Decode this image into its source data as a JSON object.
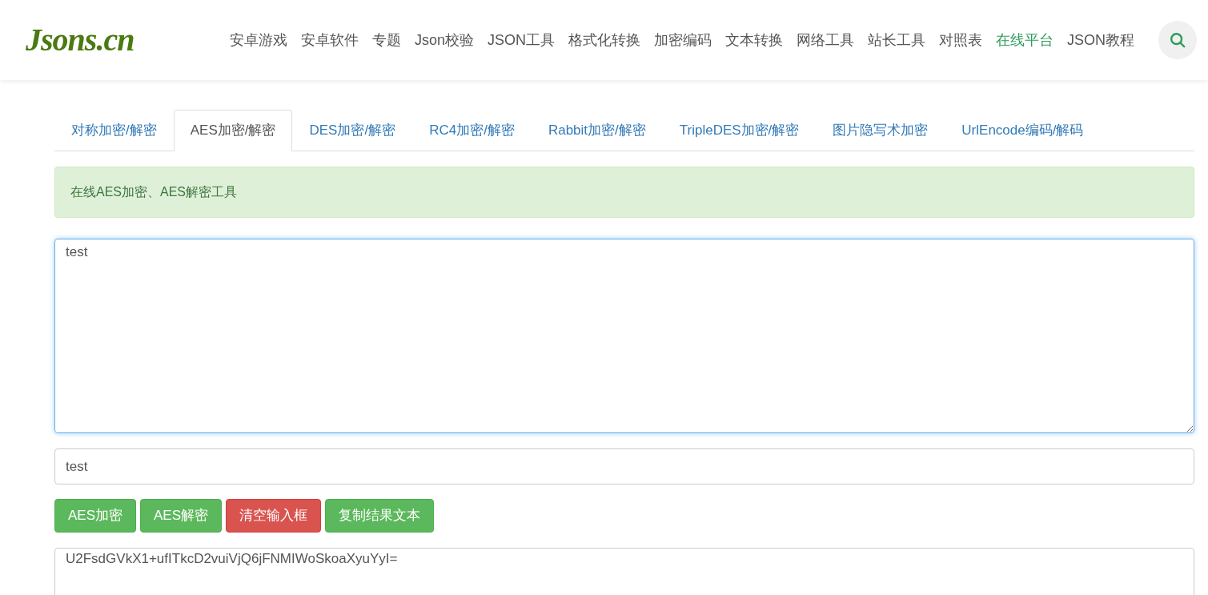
{
  "logo": "Jsons.cn",
  "nav": [
    {
      "label": "安卓游戏",
      "selected": false
    },
    {
      "label": "安卓软件",
      "selected": false
    },
    {
      "label": "专题",
      "selected": false
    },
    {
      "label": "Json校验",
      "selected": false
    },
    {
      "label": "JSON工具",
      "selected": false
    },
    {
      "label": "格式化转换",
      "selected": false
    },
    {
      "label": "加密编码",
      "selected": false
    },
    {
      "label": "文本转换",
      "selected": false
    },
    {
      "label": "网络工具",
      "selected": false
    },
    {
      "label": "站长工具",
      "selected": false
    },
    {
      "label": "对照表",
      "selected": false
    },
    {
      "label": "在线平台",
      "selected": true
    },
    {
      "label": "JSON教程",
      "selected": false
    }
  ],
  "tabs": [
    {
      "label": "对称加密/解密",
      "selected": false
    },
    {
      "label": "AES加密/解密",
      "selected": true
    },
    {
      "label": "DES加密/解密",
      "selected": false
    },
    {
      "label": "RC4加密/解密",
      "selected": false
    },
    {
      "label": "Rabbit加密/解密",
      "selected": false
    },
    {
      "label": "TripleDES加密/解密",
      "selected": false
    },
    {
      "label": "图片隐写术加密",
      "selected": false
    },
    {
      "label": "UrlEncode编码/解码",
      "selected": false
    }
  ],
  "notice": "在线AES加密、AES解密工具",
  "input_text": {
    "value": "test"
  },
  "key_field": {
    "value": "test"
  },
  "buttons": [
    {
      "label": "AES加密",
      "kind": "success"
    },
    {
      "label": "AES解密",
      "kind": "success"
    },
    {
      "label": "清空输入框",
      "kind": "danger"
    },
    {
      "label": "复制结果文本",
      "kind": "success"
    }
  ],
  "output_text": {
    "value": "U2FsdGVkX1+ufITkcD2vuiVjQ6jFNMIWoSkoaXyuYyI="
  }
}
